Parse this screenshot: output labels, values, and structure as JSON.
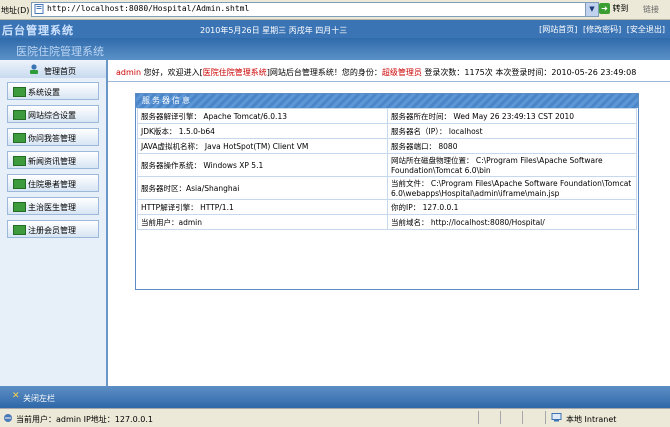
{
  "browser": {
    "address_label": "地址(D)",
    "url": "http://localhost:8080/Hospital/Admin.shtml",
    "go_label": "转到",
    "links_label": "链接"
  },
  "header": {
    "logo": "后台管理系统",
    "date": "2010年5月26日 星期三 丙戌年 四月十三",
    "links": [
      "[网站首页]",
      "[修改密码]",
      "[安全退出]"
    ],
    "system_title": "医院住院管理系统"
  },
  "sidebar": {
    "title": "管理首页",
    "items": [
      {
        "label": "系统设置"
      },
      {
        "label": "网站综合设置"
      },
      {
        "label": "你问我答管理"
      },
      {
        "label": "新闻资讯管理"
      },
      {
        "label": "住院患者管理"
      },
      {
        "label": "主治医生管理"
      },
      {
        "label": "注册会员管理"
      }
    ]
  },
  "welcome": {
    "user": "admin",
    "text1": " 您好，欢迎进入[",
    "site": "医院住院管理系统",
    "text2": "]网站后台管理系统！您的身份：",
    "role": "超级管理员",
    "text3": " 登录次数：1175次 本次登录时间：2010-05-26 23:49:08"
  },
  "server_info": {
    "title": "服务器信息",
    "rows": [
      [
        "服务器解译引擎： Apache Tomcat/6.0.13",
        "服务器所在时间： Wed May 26 23:49:13 CST 2010"
      ],
      [
        "JDK版本： 1.5.0-b64",
        "服务器名（IP）： localhost"
      ],
      [
        "JAVA虚拟机名称： Java HotSpot(TM) Client VM",
        "服务器端口： 8080"
      ],
      [
        "服务器操作系统： Windows XP 5.1",
        "网站所在磁盘物理位置： C:\\Program Files\\Apache Software Foundation\\Tomcat 6.0\\bin"
      ],
      [
        "服务器时区：Asia/Shanghai",
        "当前文件： C:\\Program Files\\Apache Software Foundation\\Tomcat 6.0\\webapps\\Hospital\\admin\\iframe\\main.jsp"
      ],
      [
        "HTTP解译引擎： HTTP/1.1",
        "你的IP： 127.0.0.1"
      ],
      [
        "当前用户：admin",
        "当前域名： http://localhost:8080/Hospital/"
      ]
    ]
  },
  "footer": {
    "close_label": "关闭左栏"
  },
  "status": {
    "text": "当前用户：admin  IP地址：127.0.0.1",
    "zone": "本地 Intranet"
  }
}
